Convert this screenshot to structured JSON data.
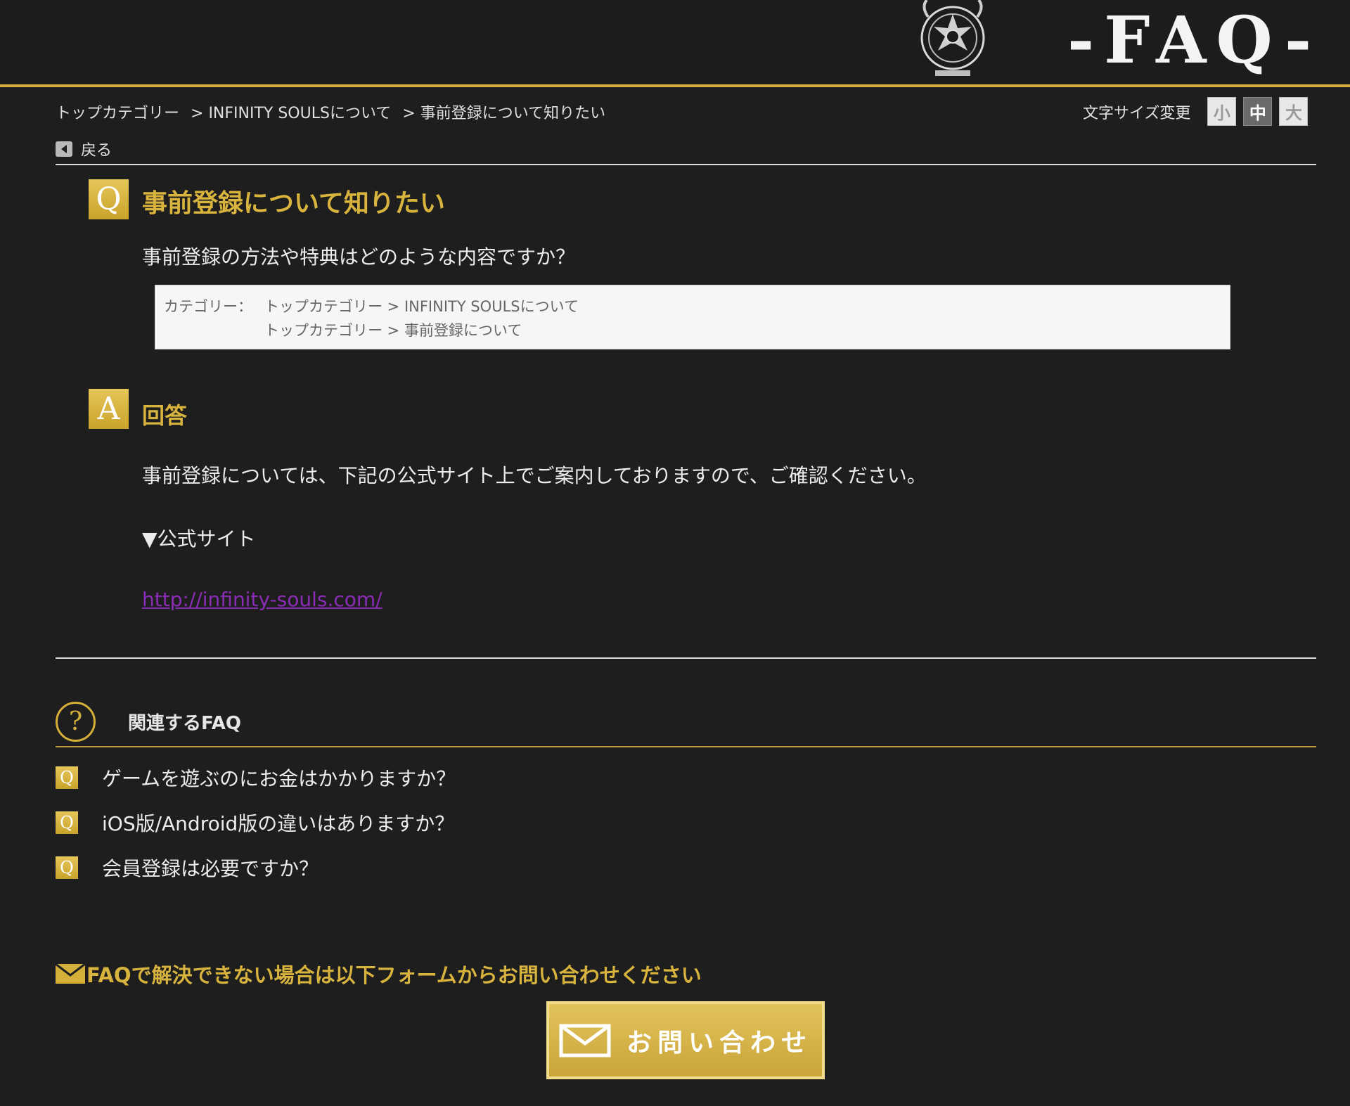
{
  "header": {
    "logo_text": "-FAQ-"
  },
  "breadcrumb": {
    "items": [
      "トップカテゴリー",
      "> INFINITY SOULSについて",
      "> 事前登録について知りたい"
    ]
  },
  "font_size": {
    "label": "文字サイズ変更",
    "small": "小",
    "medium": "中",
    "large": "大",
    "selected": "中"
  },
  "nav": {
    "back_label": "戻る"
  },
  "question": {
    "badge": "Q",
    "title": "事前登録について知りたい",
    "body": "事前登録の方法や特典はどのような内容ですか？",
    "category_label": "カテゴリー：",
    "categories": [
      "トップカテゴリー > INFINITY SOULSについて",
      "トップカテゴリー > 事前登録について"
    ]
  },
  "answer": {
    "badge": "A",
    "title": "回答",
    "body": "事前登録については、下記の公式サイト上でご案内しておりますので、ご確認ください。",
    "official_label": "▼公式サイト",
    "link": "http://infinity-souls.com/"
  },
  "related": {
    "icon_char": "?",
    "title": "関連するFAQ",
    "badge": "Q",
    "items": [
      "ゲームを遊ぶのにお金はかかりますか？",
      "iOS版/Android版の違いはありますか？",
      "会員登録は必要ですか？"
    ]
  },
  "contact": {
    "note": "FAQで解決できない場合は以下フォームからお問い合わせください",
    "button_label": "お問い合わせ"
  },
  "colors": {
    "accent": "#d4b03a",
    "background": "#1e1e1e",
    "link": "#8a2cb6"
  },
  "icons": {
    "emblem": "crest-emblem-icon",
    "back": "arrow-left-icon",
    "related": "question-circle-icon",
    "mail": "envelope-icon"
  }
}
